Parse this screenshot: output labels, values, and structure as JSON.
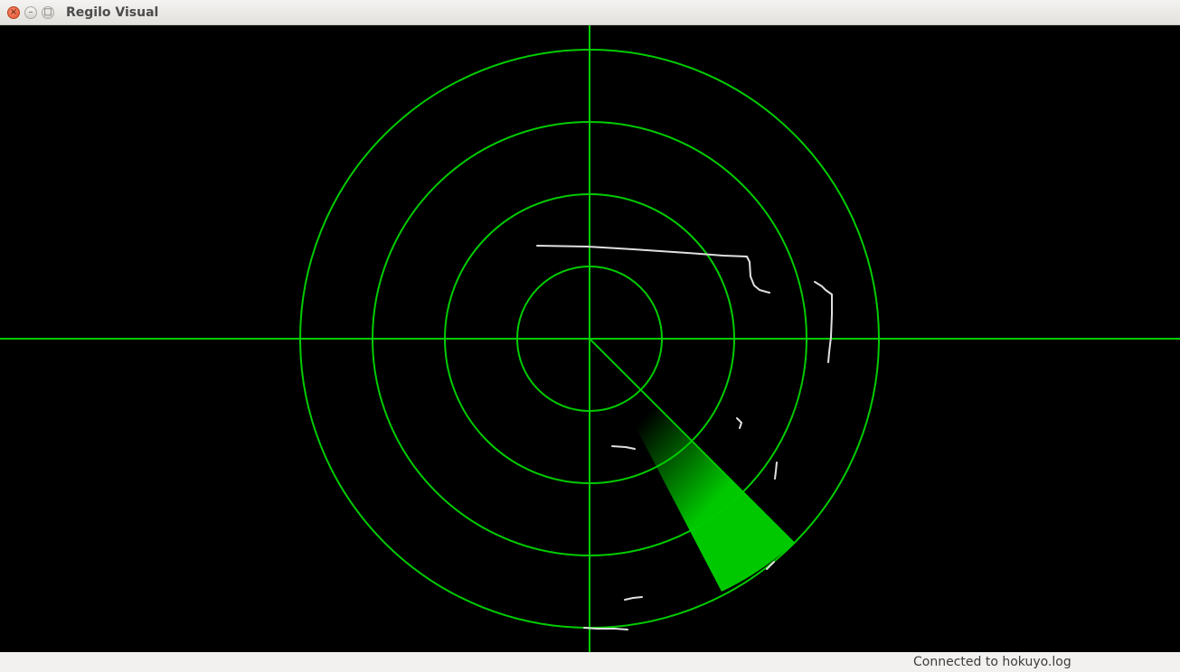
{
  "window": {
    "title": "Regilo Visual",
    "close_glyph": "×",
    "min_glyph": "–",
    "max_glyph": "□"
  },
  "radar": {
    "ring_count": 4,
    "sweep_angle_deg": 45,
    "colors": {
      "background": "#000000",
      "grid": "#00cc00",
      "sweep": "#00c800",
      "points": "#e0e0e0"
    }
  },
  "statusbar": {
    "text": "Connected to hokuyo.log"
  }
}
